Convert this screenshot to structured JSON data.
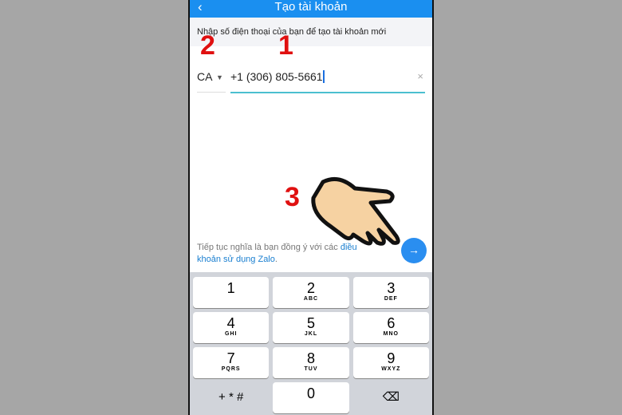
{
  "header": {
    "title": "Tạo tài khoản",
    "back_icon": "chevron-left-icon"
  },
  "hint": "Nhập số điện thoại của bạn để tạo tài khoản mới",
  "country": {
    "code": "CA"
  },
  "phone": {
    "value": "+1 (306) 805-5661",
    "clear_icon": "×"
  },
  "terms": {
    "text": "Tiếp tục nghĩa là bạn đồng ý với các ",
    "link": "điều khoản sử dụng Zalo",
    "end": "."
  },
  "next": {
    "icon": "→"
  },
  "keyboard": {
    "keys": [
      {
        "d": "1",
        "l": ""
      },
      {
        "d": "2",
        "l": "ABC"
      },
      {
        "d": "3",
        "l": "DEF"
      },
      {
        "d": "4",
        "l": "GHI"
      },
      {
        "d": "5",
        "l": "JKL"
      },
      {
        "d": "6",
        "l": "MNO"
      },
      {
        "d": "7",
        "l": "PQRS"
      },
      {
        "d": "8",
        "l": "TUV"
      },
      {
        "d": "9",
        "l": "WXYZ"
      },
      {
        "d": "+ * #",
        "l": ""
      },
      {
        "d": "0",
        "l": ""
      },
      {
        "d": "⌫",
        "l": ""
      }
    ]
  },
  "annotations": {
    "a1": "1",
    "a2": "2",
    "a3": "3"
  },
  "colors": {
    "accent": "#1a8ff0",
    "annotation": "#e01010"
  }
}
